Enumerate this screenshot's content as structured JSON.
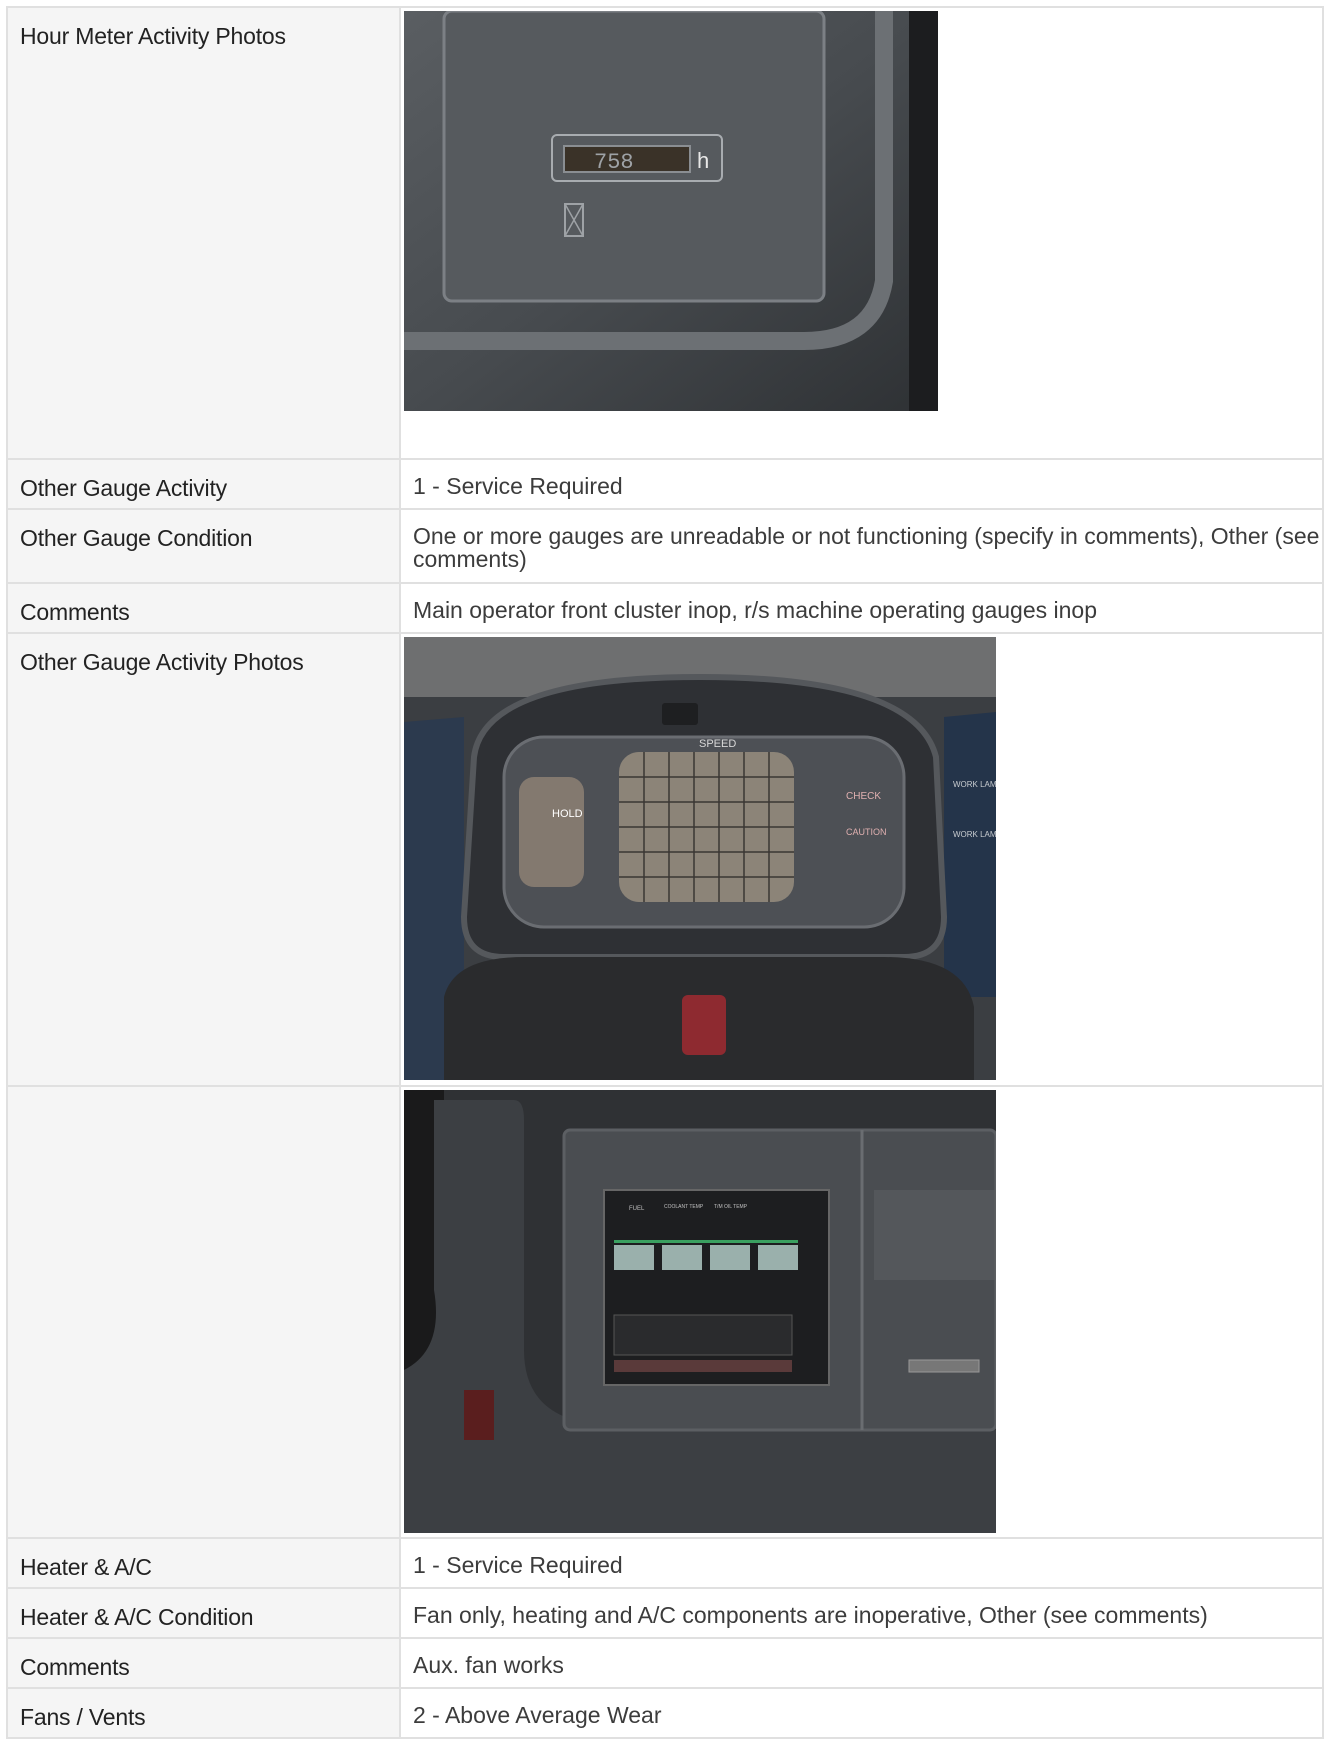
{
  "rows": [
    {
      "label": "Hour Meter Activity Photos",
      "photo_icon": "hour-meter-photo"
    },
    {
      "label": "Other Gauge Activity",
      "value": "1 - Service Required"
    },
    {
      "label": "Other Gauge Condition",
      "value": "One or more gauges are unreadable or not functioning (specify in comments), Other (see comments)"
    },
    {
      "label": "Comments",
      "value": "Main operator front cluster inop, r/s machine operating gauges inop"
    },
    {
      "label": "Other Gauge Activity Photos",
      "photo_icon": "dash-cluster-photo"
    },
    {
      "label": "",
      "photo_icon": "gauge-panel-photo"
    },
    {
      "label": "Heater & A/C",
      "value": "1 - Service Required"
    },
    {
      "label": "Heater & A/C Condition",
      "value": "Fan only, heating and A/C components are inoperative, Other (see comments)"
    },
    {
      "label": "Comments",
      "value": "Aux. fan works"
    },
    {
      "label": "Fans / Vents",
      "value": "2 - Above Average Wear"
    }
  ],
  "photos": {
    "hour_meter_reading": "758",
    "hour_meter_unit": "h",
    "dash_labels": [
      "SPEED",
      "HOLD",
      "CHECK",
      "CAUTION",
      "WORK LAMP",
      "WORK LAMP"
    ],
    "gauge_labels": [
      "FUEL",
      "COOLANT TEMP",
      "T/M OIL TEMP"
    ]
  }
}
